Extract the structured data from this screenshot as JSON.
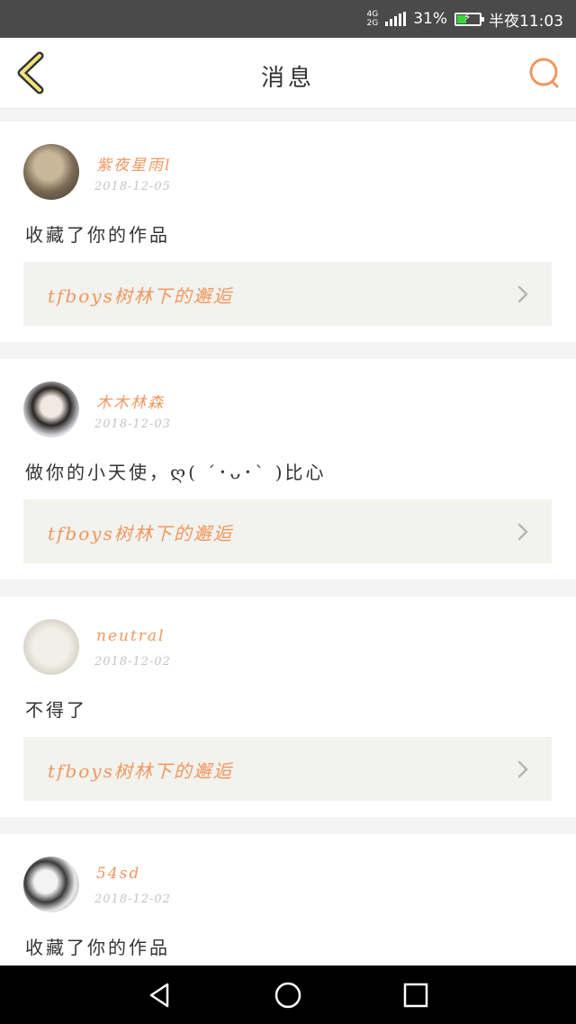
{
  "status_bar": {
    "network_top": "4G",
    "network_bottom": "2G",
    "battery_percent": "31%",
    "time": "半夜11:03"
  },
  "header": {
    "title": "消息",
    "back_icon": "chevron-left-icon",
    "search_icon": "search-icon"
  },
  "messages": [
    {
      "username": "紫夜星雨l",
      "date": "2018-12-05",
      "text": "收藏了你的作品",
      "work_title": "tfboys树林下的邂逅"
    },
    {
      "username": "木木林森",
      "date": "2018-12-03",
      "text": "做你的小天使，ღ( ´･ᴗ･` )比心",
      "work_title": "tfboys树林下的邂逅"
    },
    {
      "username": "neutral",
      "date": "2018-12-02",
      "text": "不得了",
      "work_title": "tfboys树林下的邂逅"
    },
    {
      "username": "54sd",
      "date": "2018-12-02",
      "text": "收藏了你的作品",
      "work_title": ""
    }
  ],
  "colors": {
    "accent": "#f0975e",
    "status_bar": "#4a4a4a",
    "link_bg": "#f2f2ee"
  }
}
